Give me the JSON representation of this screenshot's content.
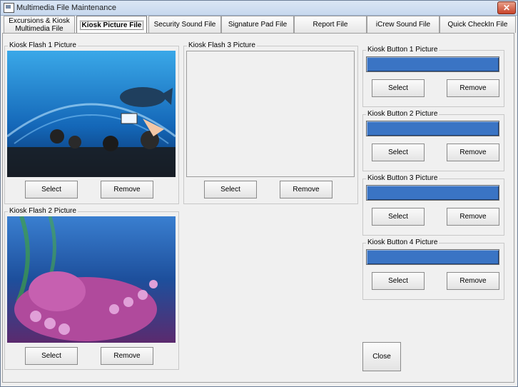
{
  "window": {
    "title": "Multimedia File Maintenance"
  },
  "tabs": [
    {
      "label": "Excursions & Kiosk Multimedia File"
    },
    {
      "label": "Kiosk Picture File"
    },
    {
      "label": "Security Sound File"
    },
    {
      "label": "Signature Pad File"
    },
    {
      "label": "Report File"
    },
    {
      "label": "iCrew Sound File"
    },
    {
      "label": "Quick CheckIn File"
    }
  ],
  "flash": [
    {
      "title": "Kiosk Flash 1 Picture",
      "select": "Select",
      "remove": "Remove"
    },
    {
      "title": "Kiosk Flash 2 Picture",
      "select": "Select",
      "remove": "Remove"
    },
    {
      "title": "Kiosk Flash 3 Picture",
      "select": "Select",
      "remove": "Remove"
    }
  ],
  "buttons": [
    {
      "title": "Kiosk Button 1 Picture",
      "select": "Select",
      "remove": "Remove"
    },
    {
      "title": "Kiosk Button 2 Picture",
      "select": "Select",
      "remove": "Remove"
    },
    {
      "title": "Kiosk Button 3 Picture",
      "select": "Select",
      "remove": "Remove"
    },
    {
      "title": "Kiosk Button 4 Picture",
      "select": "Select",
      "remove": "Remove"
    }
  ],
  "close_label": "Close",
  "colors": {
    "button_bar": "#3a74c4",
    "accent": "#0a246a"
  }
}
